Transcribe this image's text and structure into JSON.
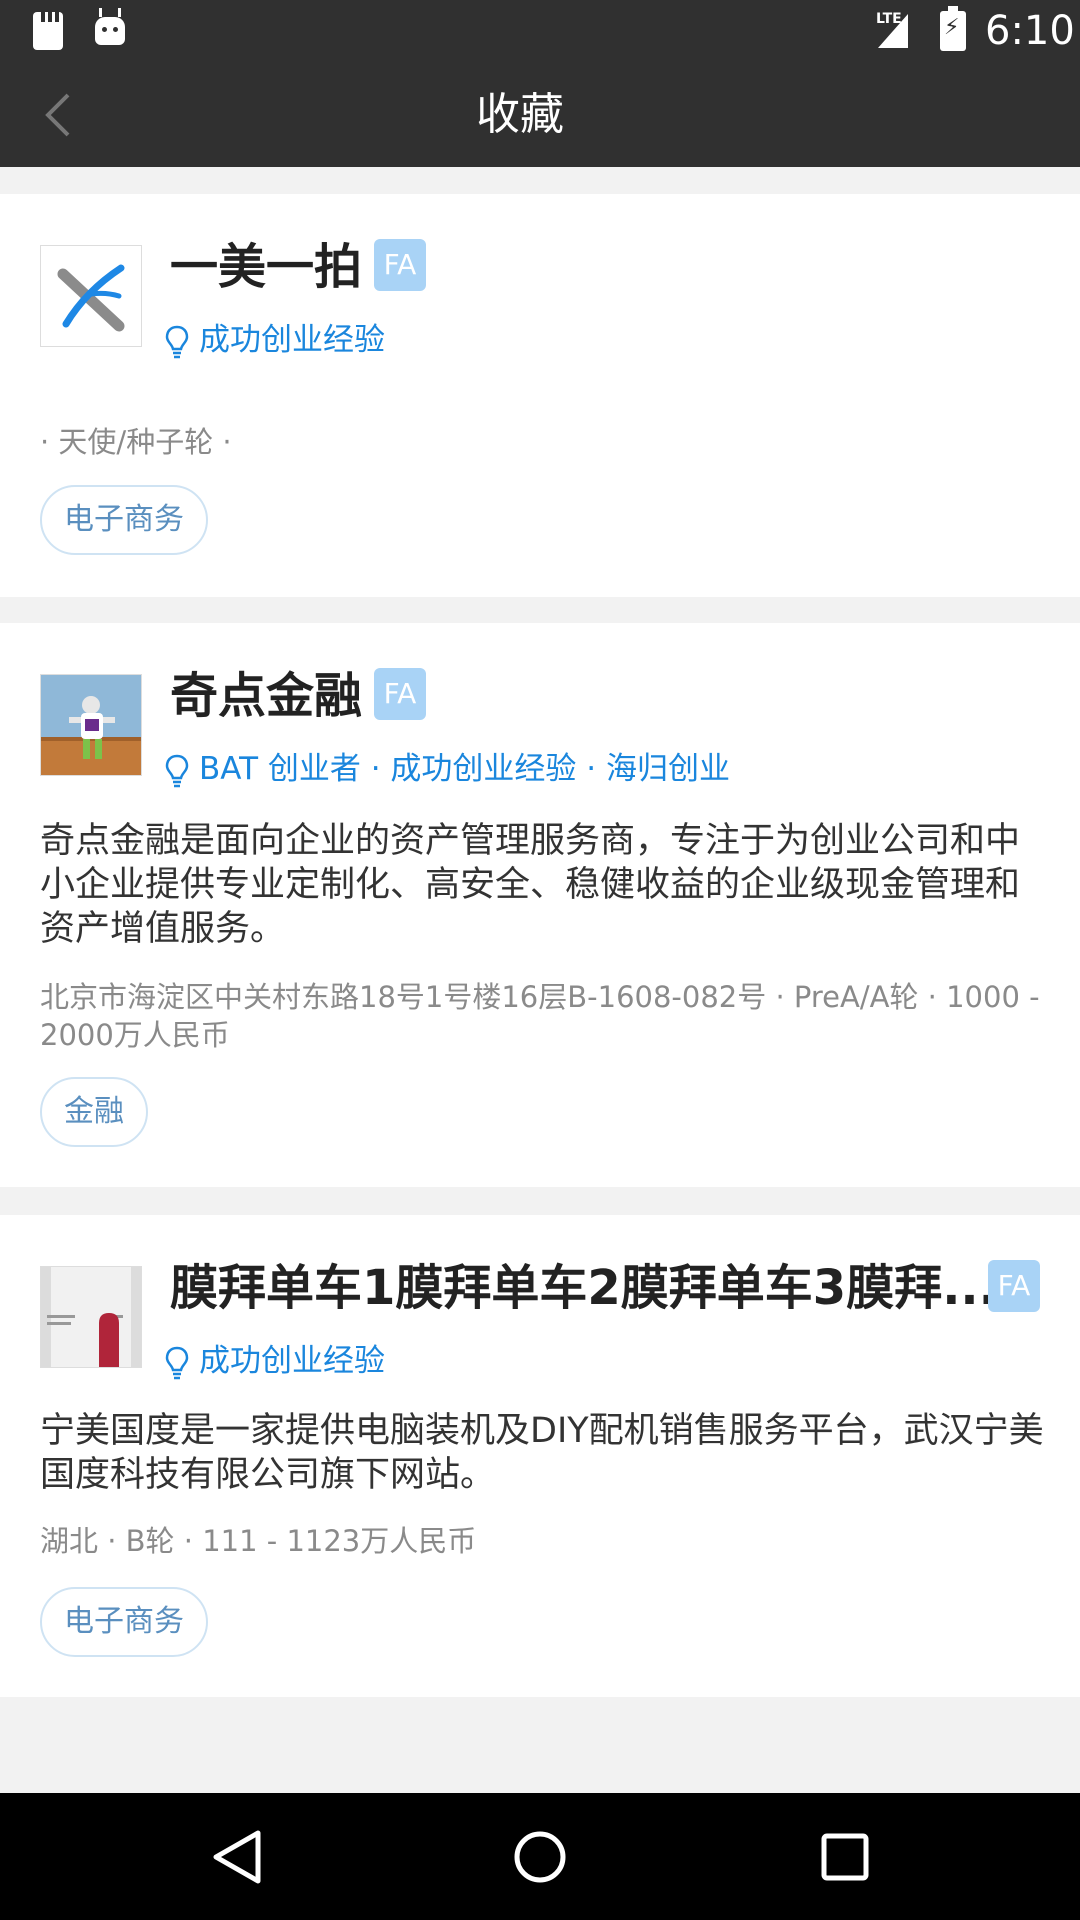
{
  "status_bar": {
    "network": "LTE",
    "time": "6:10"
  },
  "app_bar": {
    "title": "收藏"
  },
  "cards": [
    {
      "name": "一美一拍",
      "fa_badge": "FA",
      "tags": "成功创业经验",
      "description": "",
      "meta": "· 天使/种子轮 ·",
      "chip": "电子商务"
    },
    {
      "name": "奇点金融",
      "fa_badge": "FA",
      "tags": "BAT 创业者 · 成功创业经验 · 海归创业",
      "description": "奇点金融是面向企业的资产管理服务商，专注于为创业公司和中小企业提供专业定制化、高安全、稳健收益的企业级现金管理和资产增值服务。",
      "meta": "北京市海淀区中关村东路18号1号楼16层B-1608-082号 · PreA/A轮 · 1000 - 2000万人民币",
      "chip": "金融"
    },
    {
      "name": "膜拜单车1膜拜单车2膜拜单车3膜拜...",
      "fa_badge": "FA",
      "tags": "成功创业经验",
      "description": "宁美国度是一家提供电脑装机及DIY配机销售服务平台，武汉宁美国度科技有限公司旗下网站。",
      "meta": "湖北 · B轮 · 111 - 1123万人民币",
      "chip": "电子商务"
    }
  ],
  "colors": {
    "bar": "#303030",
    "link": "#1a86dd",
    "fa": "#a9d3f6"
  }
}
